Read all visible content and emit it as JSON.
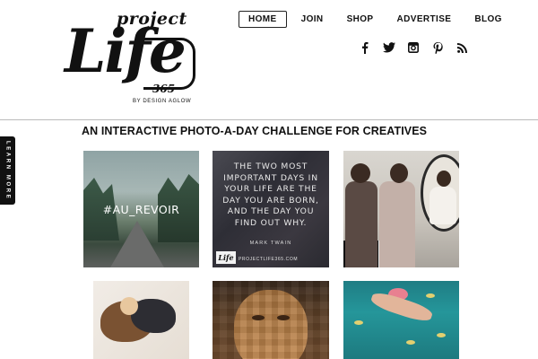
{
  "logo": {
    "project": "project",
    "life": "Life",
    "number": "365",
    "byline": "BY DESIGN AGLOW"
  },
  "nav": {
    "items": [
      {
        "label": "HOME",
        "active": true
      },
      {
        "label": "JOIN"
      },
      {
        "label": "SHOP"
      },
      {
        "label": "ADVERTISE"
      },
      {
        "label": "BLOG"
      }
    ]
  },
  "social": [
    "facebook-icon",
    "twitter-icon",
    "instagram-icon",
    "pinterest-icon",
    "rss-icon"
  ],
  "side_tab": {
    "label": "LEARN MORE"
  },
  "tagline": "AN INTERACTIVE PHOTO-A-DAY CHALLENGE FOR CREATIVES",
  "tiles": {
    "t1": {
      "overlay": "#AU_REVOIR"
    },
    "t2": {
      "quote": "THE TWO MOST IMPORTANT DAYS IN YOUR LIFE ARE THE DAY YOU ARE BORN, AND THE DAY YOU FIND OUT WHY.",
      "author": "MARK TWAIN",
      "logo": "Life",
      "url": "PROJECTLIFE365.COM"
    }
  }
}
